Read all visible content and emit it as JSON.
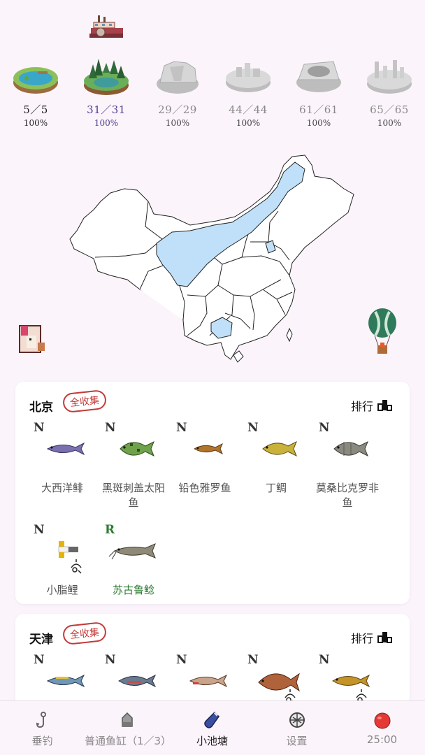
{
  "header": {
    "boat_icon": "paddle-steamer-icon"
  },
  "islands": [
    {
      "count": "5／5",
      "percent": "100%",
      "state": "done",
      "icon": "pond-island-icon"
    },
    {
      "count": "31／31",
      "percent": "100%",
      "state": "active",
      "icon": "forest-island-icon"
    },
    {
      "count": "29／29",
      "percent": "100%",
      "state": "dim",
      "icon": "canyon-island-icon"
    },
    {
      "count": "44／44",
      "percent": "100%",
      "state": "dim",
      "icon": "city-island-icon"
    },
    {
      "count": "61／61",
      "percent": "100%",
      "state": "dim",
      "icon": "crater-island-icon"
    },
    {
      "count": "65／65",
      "percent": "100%",
      "state": "dim",
      "icon": "ruins-island-icon"
    }
  ],
  "map": {
    "highlight_color": "#bfe0f8",
    "border_color": "#222222"
  },
  "sections": [
    {
      "city": "北京",
      "badge": "全收集",
      "rank_label": "排行",
      "fish": [
        {
          "rarity": "N",
          "name": "大西洋鲱",
          "color": "#7b6fb0"
        },
        {
          "rarity": "N",
          "name": "黑斑刺盖太阳鱼",
          "color": "#6fa24a"
        },
        {
          "rarity": "N",
          "name": "铅色雅罗鱼",
          "color": "#b0742c"
        },
        {
          "rarity": "N",
          "name": "丁鲷",
          "color": "#c9b23a"
        },
        {
          "rarity": "N",
          "name": "莫桑比克罗非鱼",
          "color": "#8a8a80"
        },
        {
          "rarity": "N",
          "name": "小脂鲤",
          "color": "#e5b400"
        },
        {
          "rarity": "R",
          "name": "苏古鲁鲶",
          "color": "#8f8a78"
        }
      ]
    },
    {
      "city": "天津",
      "badge": "全收集",
      "rank_label": "排行",
      "fish": [
        {
          "rarity": "N",
          "color": "#6f98b8"
        },
        {
          "rarity": "N",
          "color": "#6a7a90"
        },
        {
          "rarity": "N",
          "color": "#c9a48a"
        },
        {
          "rarity": "N",
          "color": "#b0623a"
        },
        {
          "rarity": "N",
          "color": "#c49428"
        }
      ]
    }
  ],
  "tabs": [
    {
      "label": "垂钓",
      "icon": "fishing-hook-icon"
    },
    {
      "label": "普通鱼缸（1／3）",
      "icon": "fish-tank-icon"
    },
    {
      "label": "小池塘",
      "icon": "pond-bottle-icon",
      "active": true
    },
    {
      "label": "设置",
      "icon": "settings-icon"
    },
    {
      "label": "25:00",
      "icon": "tomato-timer-icon"
    }
  ]
}
